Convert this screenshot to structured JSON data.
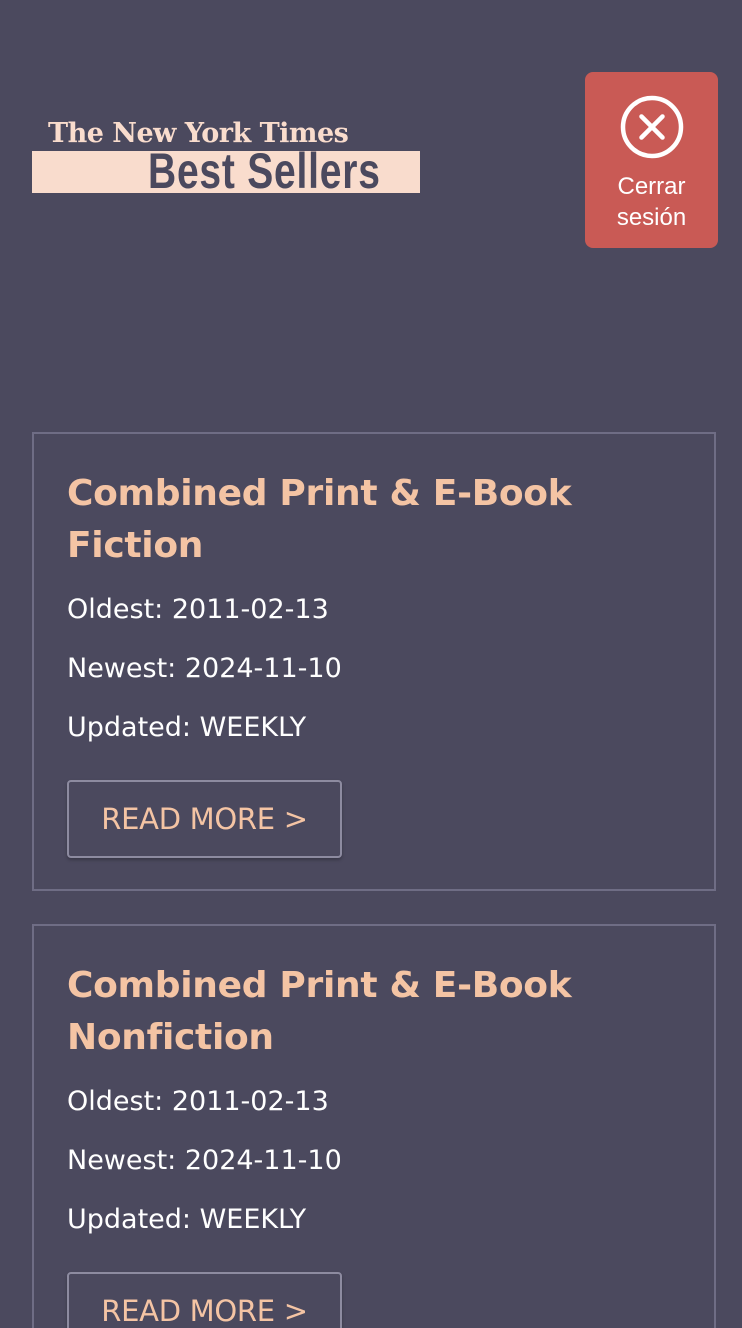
{
  "header": {
    "logo_top": "The New York Times",
    "logo_bottom": "Best Sellers",
    "logout_label": "Cerrar sesión",
    "logout_color": "#c95a55"
  },
  "lists": [
    {
      "title": "Combined Print & E-Book Fiction",
      "oldest": "Oldest: 2011-02-13",
      "newest": "Newest: 2024-11-10",
      "updated": "Updated: WEEKLY",
      "button": "READ MORE >"
    },
    {
      "title": "Combined Print & E-Book Nonfiction",
      "oldest": "Oldest: 2011-02-13",
      "newest": "Newest: 2024-11-10",
      "updated": "Updated: WEEKLY",
      "button": "READ MORE >"
    }
  ],
  "colors": {
    "background": "#4b495e",
    "accent": "#f4c4a4",
    "logo": "#f9dccd"
  },
  "icons": {
    "logout": "close-circle-icon"
  }
}
